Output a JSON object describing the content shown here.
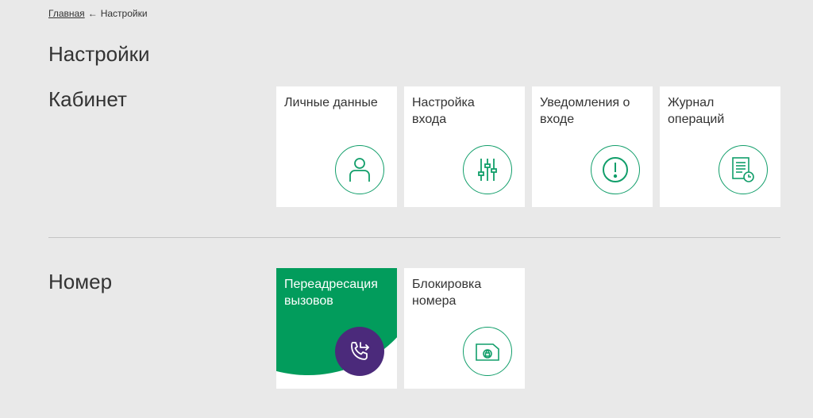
{
  "breadcrumb": {
    "home": "Главная",
    "separator": "←",
    "current": "Настройки"
  },
  "page_title": "Настройки",
  "sections": {
    "cabinet": {
      "title": "Кабинет",
      "tiles": [
        {
          "label": "Личные данные",
          "icon": "user-icon"
        },
        {
          "label": "Настройка\nвхода",
          "icon": "sliders-icon"
        },
        {
          "label": "Уведомления о\nвходе",
          "icon": "alert-icon"
        },
        {
          "label": "Журнал\nопераций",
          "icon": "journal-icon"
        }
      ]
    },
    "number": {
      "title": "Номер",
      "tiles": [
        {
          "label": "Переадресация\nвызовов",
          "icon": "call-forward-icon"
        },
        {
          "label": "Блокировка\nномера",
          "icon": "sim-lock-icon"
        }
      ]
    }
  },
  "colors": {
    "background": "#e9e9e9",
    "accent_green": "#119e6a",
    "highlight_green": "#029c5c",
    "highlight_purple": "#4b2a7b",
    "divider": "#c4c4c4"
  }
}
